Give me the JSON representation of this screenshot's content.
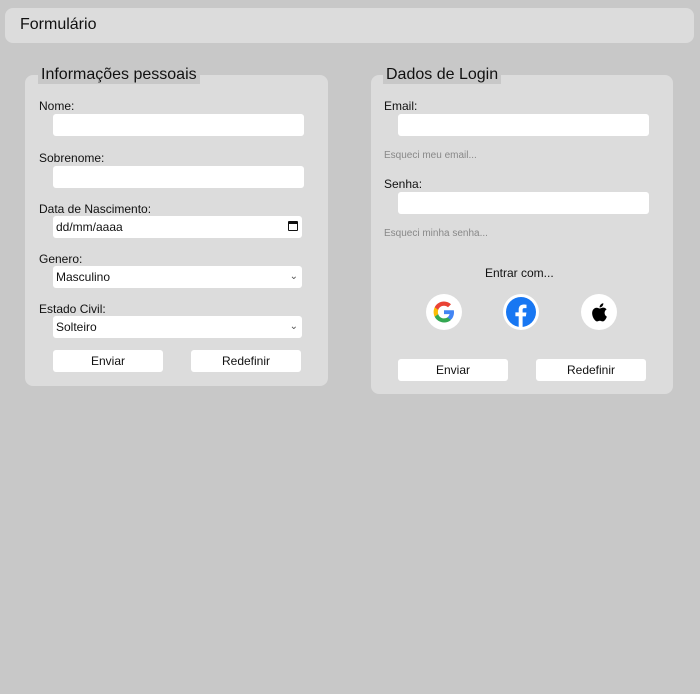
{
  "header": {
    "title": "Formulário"
  },
  "personal": {
    "legend": "Informações pessoais",
    "nome_label": "Nome:",
    "nome_value": "",
    "sobrenome_label": "Sobrenome:",
    "sobrenome_value": "",
    "nascimento_label": "Data de Nascimento:",
    "nascimento_placeholder": "dd/mm/aaaa",
    "genero_label": "Genero:",
    "genero_value": "Masculino",
    "estado_civil_label": "Estado Civil:",
    "estado_civil_value": "Solteiro",
    "submit_label": "Enviar",
    "reset_label": "Redefinir"
  },
  "login": {
    "legend": "Dados de Login",
    "email_label": "Email:",
    "email_value": "",
    "forgot_email": "Esqueci meu email...",
    "senha_label": "Senha:",
    "senha_value": "",
    "forgot_password": "Esqueci minha senha...",
    "enter_with": "Entrar com...",
    "social": [
      "google-icon",
      "facebook-icon",
      "apple-icon"
    ],
    "submit_label": "Enviar",
    "reset_label": "Redefinir"
  },
  "colors": {
    "background": "#c8c8c8",
    "panel": "#dcdcdc",
    "facebook": "#1877f2"
  }
}
